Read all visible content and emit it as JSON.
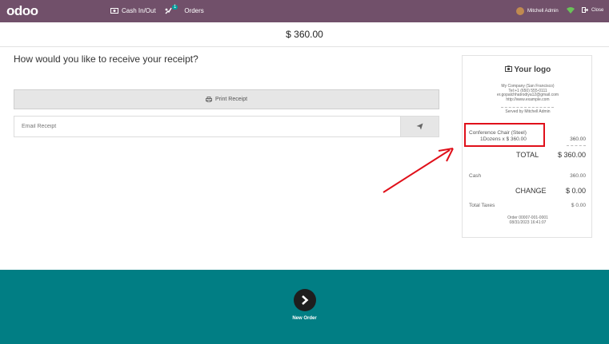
{
  "topbar": {
    "logo": "odoo",
    "cash_label": "Cash In/Out",
    "orders_label": "Orders",
    "orders_badge": "1",
    "user_name": "Mitchell Admin",
    "close_label": "Close",
    "bg_color": "#71506a"
  },
  "order_total": "$ 360.00",
  "receipt_prompt": {
    "question": "How would you like to receive your receipt?",
    "print_label": "Print Receipt",
    "email_placeholder": "Email Receipt"
  },
  "receipt": {
    "logo_text": "Your logo",
    "company": "My Company (San Francisco)",
    "tel": "Tel:+1 (650) 555-0111",
    "email": "er.gopalchhatrodiya12@gmail.com",
    "website": "http://www.example.com",
    "served_by": "Served by Mitchell Admin",
    "line_product": "Conference Chair (Steel)",
    "line_qty": "1Dozens x $ 360.00",
    "line_amount": "360.00",
    "total_label": "TOTAL",
    "total_amount": "$ 360.00",
    "cash_label": "Cash",
    "cash_amount": "360.00",
    "change_label": "CHANGE",
    "change_amount": "$ 0.00",
    "taxes_label": "Total Taxes",
    "taxes_amount": "$ 0.00",
    "order_ref": "Order 00007-001-0001",
    "order_date": "08/31/2023 16:41:07"
  },
  "footer": {
    "new_order_label": "New Order",
    "bg_color": "#017e84"
  },
  "annotation": {
    "color": "#e0101a"
  }
}
